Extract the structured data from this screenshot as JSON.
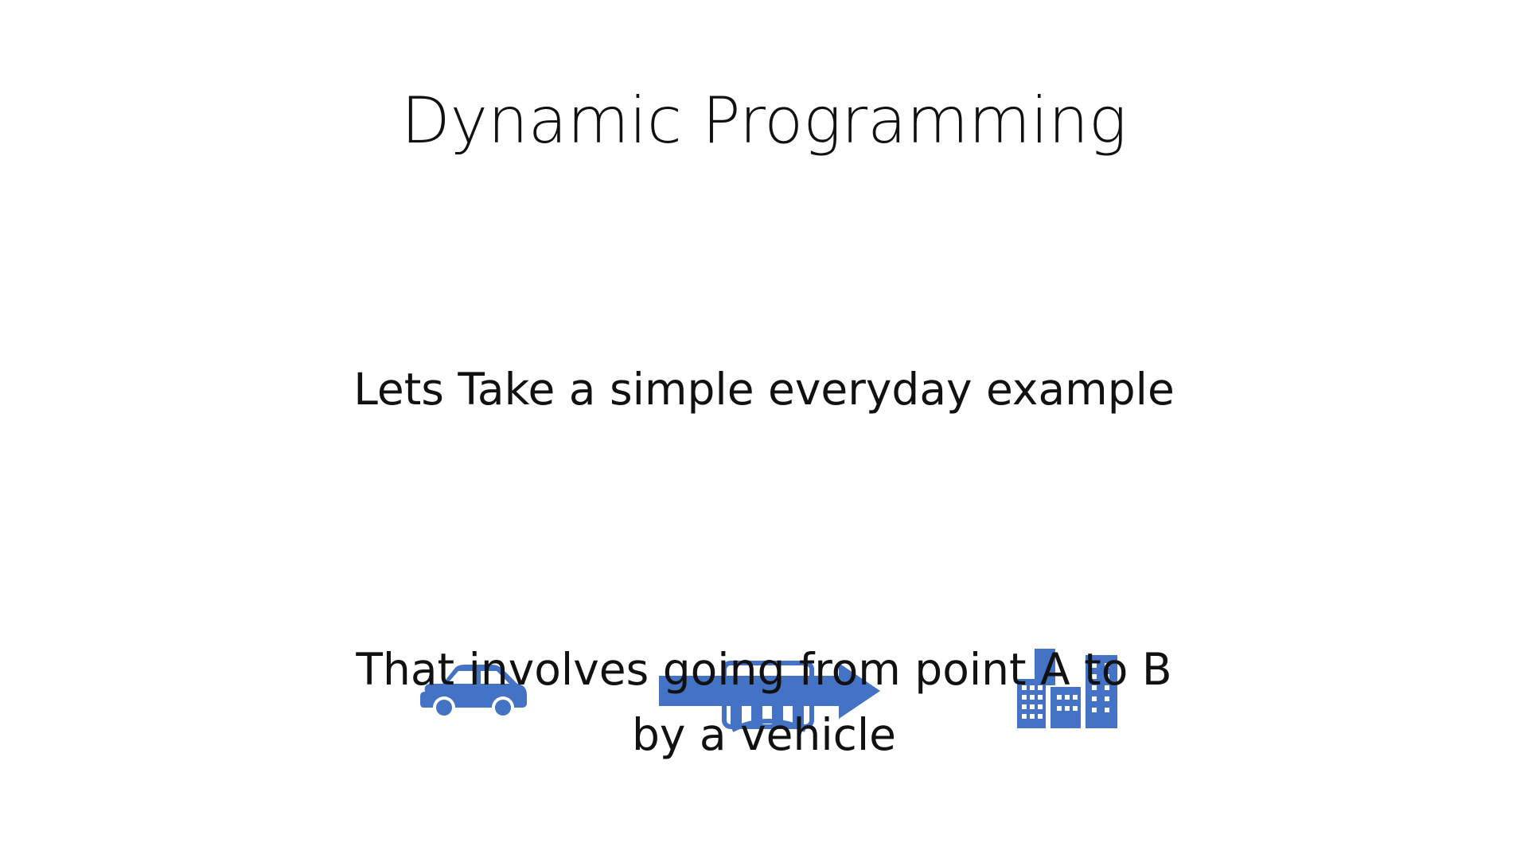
{
  "slide": {
    "title": "Dynamic Programming",
    "subtitle": "Lets Take a simple everyday example",
    "body_line1": "That involves going from point  A to B",
    "body_line2": "by a vehicle"
  },
  "icons": {
    "car": "car-icon",
    "arrow": "right-arrow-icon",
    "bus": "bus-icon",
    "city": "city-buildings-icon"
  },
  "colors": {
    "accent": "#4472C4",
    "text": "#111111",
    "background": "#ffffff"
  }
}
